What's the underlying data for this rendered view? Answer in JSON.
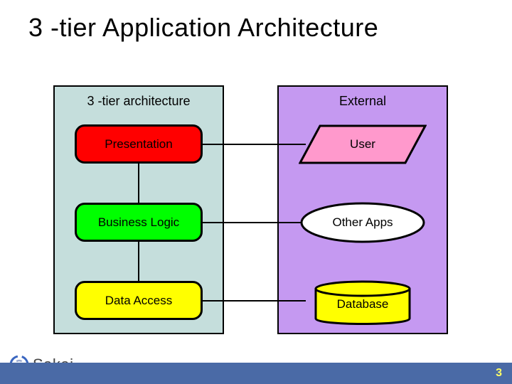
{
  "title": "3 -tier Application Architecture",
  "left_panel": {
    "title": "3 -tier architecture",
    "boxes": {
      "presentation": "Presentation",
      "business": "Business Logic",
      "data": "Data Access"
    }
  },
  "right_panel": {
    "title": "External",
    "shapes": {
      "user": "User",
      "other": "Other Apps",
      "database": "Database"
    }
  },
  "logo_text": "Sakai",
  "page_number": "3",
  "colors": {
    "presentation": "#ff0000",
    "business": "#00ff00",
    "data": "#ffff00",
    "user_fill": "#ff99cc",
    "other_fill": "#ffffff",
    "db_fill": "#ffff00",
    "left_panel": "#c5dedc",
    "right_panel": "#c599f1",
    "bottom_bar": "#4a6aa6"
  }
}
